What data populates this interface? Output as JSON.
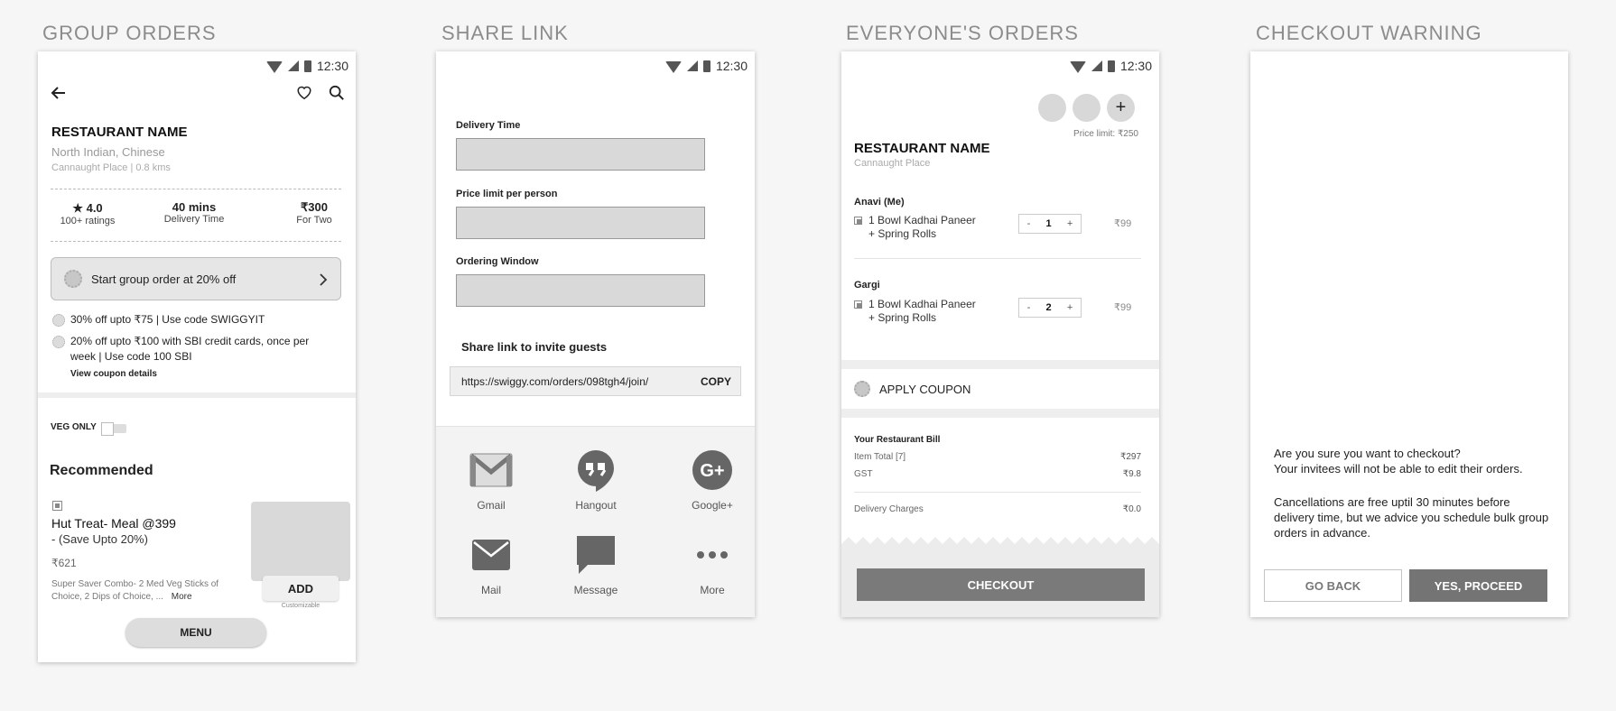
{
  "sections": [
    {
      "title": "GROUP ORDERS"
    },
    {
      "title": "SHARE LINK"
    },
    {
      "title": "EVERYONE'S ORDERS"
    },
    {
      "title": "CHECKOUT WARNING"
    }
  ],
  "status_time": "12:30",
  "group_orders": {
    "restaurant_name": "RESTAURANT NAME",
    "cuisine": "North Indian, Chinese",
    "location": "Cannaught Place | 0.8 kms",
    "rating_value": "★ 4.0",
    "rating_label": "100+ ratings",
    "delivery_value": "40 mins",
    "delivery_label": "Delivery Time",
    "cost_value": "₹300",
    "cost_label": "For Two",
    "group_button": "Start group order at 20% off",
    "offer1": "30% off upto ₹75 | Use code SWIGGYIT",
    "offer2": "20% off upto ₹100 with SBI credit cards, once per week | Use code 100 SBI",
    "coupon_link": "View coupon details",
    "veg_only": "VEG ONLY",
    "recommended": "Recommended",
    "item_title": "Hut Treat- Meal @399",
    "item_subtitle": "- (Save Upto 20%)",
    "item_price": "₹621",
    "item_desc": "Super Saver Combo- 2 Med Veg Sticks of Choice, 2 Dips of Choice, ...",
    "item_more": "More",
    "add_label": "ADD",
    "customizable": "Customizable",
    "menu_label": "MENU"
  },
  "share_link": {
    "delivery_time_label": "Delivery Time",
    "price_limit_label": "Price limit per person",
    "ordering_window_label": "Ordering Window",
    "share_heading": "Share link to invite guests",
    "url": "https://swiggy.com/orders/098tgh4/join/",
    "copy_label": "COPY",
    "apps": [
      {
        "label": "Gmail"
      },
      {
        "label": "Hangout"
      },
      {
        "label": "Google+"
      },
      {
        "label": "Mail"
      },
      {
        "label": "Message"
      },
      {
        "label": "More"
      }
    ]
  },
  "everyones_orders": {
    "price_limit": "Price limit: ₹250",
    "restaurant_name": "RESTAURANT NAME",
    "location": "Cannaught Place",
    "orders": [
      {
        "name": "Anavi (Me)",
        "item_line1": "1 Bowl Kadhai Paneer",
        "item_line2": "+ Spring Rolls",
        "qty": "1",
        "price": "₹99"
      },
      {
        "name": "Gargi",
        "item_line1": "1 Bowl Kadhai Paneer",
        "item_line2": "+ Spring Rolls",
        "qty": "2",
        "price": "₹99"
      }
    ],
    "apply_coupon": "APPLY COUPON",
    "bill_heading": "Your Restaurant Bill",
    "item_total_label": "Item Total [7]",
    "item_total_value": "₹297",
    "gst_label": "GST",
    "gst_value": "₹9.8",
    "delivery_label": "Delivery Charges",
    "delivery_value": "₹0.0",
    "checkout_label": "CHECKOUT"
  },
  "checkout_warning": {
    "line1": "Are you sure you want to checkout?",
    "line2": "Your invitees will not be able to edit their orders.",
    "note": "Cancellations are free uptil 30 minutes before delivery time, but we advice you schedule bulk group orders in advance.",
    "go_back": "GO BACK",
    "proceed": "YES, PROCEED"
  }
}
